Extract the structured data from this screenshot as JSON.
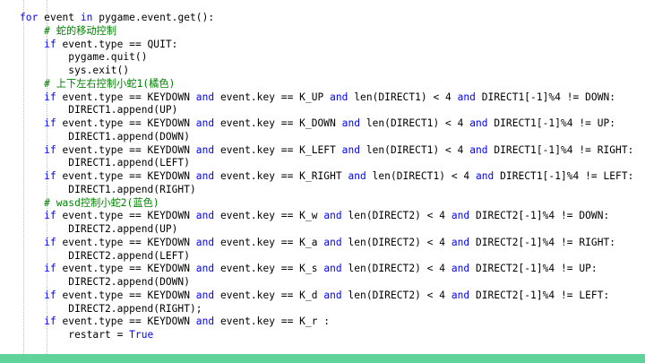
{
  "code": {
    "lines": [
      [
        {
          "t": "for ",
          "c": "kw"
        },
        {
          "t": "event "
        },
        {
          "t": "in ",
          "c": "kw"
        },
        {
          "t": "pygame.event.get():"
        }
      ],
      [
        {
          "t": "    # 蛇的移动控制",
          "c": "cm"
        }
      ],
      [
        {
          "t": "    "
        },
        {
          "t": "if ",
          "c": "kw"
        },
        {
          "t": "event.type == QUIT:"
        }
      ],
      [
        {
          "t": "        pygame.quit()"
        }
      ],
      [
        {
          "t": "        sys.exit()"
        }
      ],
      [
        {
          "t": "    # 上下左右控制小蛇1(橘色)",
          "c": "cm"
        }
      ],
      [
        {
          "t": "    "
        },
        {
          "t": "if ",
          "c": "kw"
        },
        {
          "t": "event.type == KEYDOWN "
        },
        {
          "t": "and ",
          "c": "kw"
        },
        {
          "t": "event.key == K_UP "
        },
        {
          "t": "and ",
          "c": "kw"
        },
        {
          "t": "len(DIRECT1) < 4 "
        },
        {
          "t": "and ",
          "c": "kw"
        },
        {
          "t": "DIRECT1[-1]%4 != DOWN:"
        }
      ],
      [
        {
          "t": "        DIRECT1.append(UP)"
        }
      ],
      [
        {
          "t": "    "
        },
        {
          "t": "if ",
          "c": "kw"
        },
        {
          "t": "event.type == KEYDOWN "
        },
        {
          "t": "and ",
          "c": "kw"
        },
        {
          "t": "event.key == K_DOWN "
        },
        {
          "t": "and ",
          "c": "kw"
        },
        {
          "t": "len(DIRECT1) < 4 "
        },
        {
          "t": "and ",
          "c": "kw"
        },
        {
          "t": "DIRECT1[-1]%4 != UP:"
        }
      ],
      [
        {
          "t": "        DIRECT1.append(DOWN)"
        }
      ],
      [
        {
          "t": "    "
        },
        {
          "t": "if ",
          "c": "kw"
        },
        {
          "t": "event.type == KEYDOWN "
        },
        {
          "t": "and ",
          "c": "kw"
        },
        {
          "t": "event.key == K_LEFT "
        },
        {
          "t": "and ",
          "c": "kw"
        },
        {
          "t": "len(DIRECT1) < 4 "
        },
        {
          "t": "and ",
          "c": "kw"
        },
        {
          "t": "DIRECT1[-1]%4 != RIGHT:"
        }
      ],
      [
        {
          "t": "        DIRECT1.append(LEFT)"
        }
      ],
      [
        {
          "t": "    "
        },
        {
          "t": "if ",
          "c": "kw"
        },
        {
          "t": "event.type == KEYDOWN "
        },
        {
          "t": "and ",
          "c": "kw"
        },
        {
          "t": "event.key == K_RIGHT "
        },
        {
          "t": "and ",
          "c": "kw"
        },
        {
          "t": "len(DIRECT1) < 4 "
        },
        {
          "t": "and ",
          "c": "kw"
        },
        {
          "t": "DIRECT1[-1]%4 != LEFT:"
        }
      ],
      [
        {
          "t": "        DIRECT1.append(RIGHT)"
        }
      ],
      [
        {
          "t": "    # wasd控制小蛇2(蓝色)",
          "c": "cm"
        }
      ],
      [
        {
          "t": "    "
        },
        {
          "t": "if ",
          "c": "kw"
        },
        {
          "t": "event.type == KEYDOWN "
        },
        {
          "t": "and ",
          "c": "kw"
        },
        {
          "t": "event.key == K_w "
        },
        {
          "t": "and ",
          "c": "kw"
        },
        {
          "t": "len(DIRECT2) < 4 "
        },
        {
          "t": "and ",
          "c": "kw"
        },
        {
          "t": "DIRECT2[-1]%4 != DOWN:"
        }
      ],
      [
        {
          "t": "        DIRECT2.append(UP)"
        }
      ],
      [
        {
          "t": "    "
        },
        {
          "t": "if ",
          "c": "kw"
        },
        {
          "t": "event.type == KEYDOWN "
        },
        {
          "t": "and ",
          "c": "kw"
        },
        {
          "t": "event.key == K_a "
        },
        {
          "t": "and ",
          "c": "kw"
        },
        {
          "t": "len(DIRECT2) < 4 "
        },
        {
          "t": "and ",
          "c": "kw"
        },
        {
          "t": "DIRECT2[-1]%4 != RIGHT:"
        }
      ],
      [
        {
          "t": "        DIRECT2.append(LEFT)"
        }
      ],
      [
        {
          "t": "    "
        },
        {
          "t": "if ",
          "c": "kw"
        },
        {
          "t": "event.type == KEYDOWN "
        },
        {
          "t": "and ",
          "c": "kw"
        },
        {
          "t": "event.key == K_s "
        },
        {
          "t": "and ",
          "c": "kw"
        },
        {
          "t": "len(DIRECT2) < 4 "
        },
        {
          "t": "and ",
          "c": "kw"
        },
        {
          "t": "DIRECT2[-1]%4 != UP:"
        }
      ],
      [
        {
          "t": "        DIRECT2.append(DOWN)"
        }
      ],
      [
        {
          "t": "    "
        },
        {
          "t": "if ",
          "c": "kw"
        },
        {
          "t": "event.type == KEYDOWN "
        },
        {
          "t": "and ",
          "c": "kw"
        },
        {
          "t": "event.key == K_d "
        },
        {
          "t": "and ",
          "c": "kw"
        },
        {
          "t": "len(DIRECT2) < 4 "
        },
        {
          "t": "and ",
          "c": "kw"
        },
        {
          "t": "DIRECT2[-1]%4 != LEFT:"
        }
      ],
      [
        {
          "t": "        DIRECT2.append(RIGHT);"
        }
      ],
      [
        {
          "t": "    "
        },
        {
          "t": "if ",
          "c": "kw"
        },
        {
          "t": "event.type == KEYDOWN "
        },
        {
          "t": "and ",
          "c": "kw"
        },
        {
          "t": "event.key == K_r :"
        }
      ],
      [
        {
          "t": "        restart = "
        },
        {
          "t": "True",
          "c": "kw"
        }
      ]
    ]
  },
  "colors": {
    "keyword": "#0000ff",
    "comment": "#008000",
    "text": "#000000",
    "accent_bar": "#5fd39a"
  }
}
